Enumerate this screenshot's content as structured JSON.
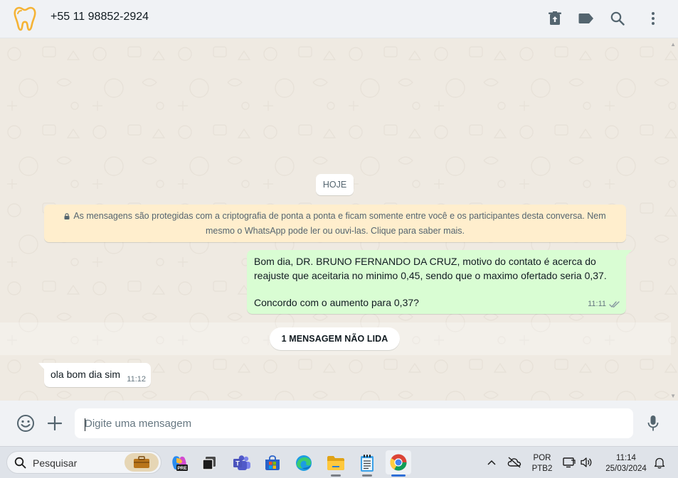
{
  "header": {
    "contact_name": "+55 11 98852-2924",
    "icons": [
      "tooth-logo-icon",
      "archive-icon",
      "label-icon",
      "search-icon",
      "more-vertical-icon"
    ]
  },
  "chat": {
    "date_separator": "HOJE",
    "encryption_notice": {
      "line1": "As mensagens são protegidas com a criptografia de ponta a ponta e ficam somente entre você e os participantes desta conversa. Nem",
      "line2": "mesmo o WhatsApp pode ler ou ouvi-las. Clique para saber mais."
    },
    "outgoing_message": {
      "line1": "Bom dia,  DR. BRUNO FERNANDO DA CRUZ, motivo do contato é acerca do",
      "line2": "reajuste que aceitaria no minimo 0,45, sendo que o maximo ofertado seria 0,37.",
      "line3": "Concordo com o aumento para 0,37?",
      "time": "11:11",
      "status": "read"
    },
    "unread_divider": "1 MENSAGEM NÃO LIDA",
    "incoming_message": {
      "text": "ola bom dia sim",
      "time": "11:12"
    }
  },
  "composer": {
    "placeholder": "Digite uma mensagem",
    "value": ""
  },
  "taskbar": {
    "search_label": "Pesquisar",
    "apps": [
      "work-briefcase-icon",
      "copilot-pre-icon",
      "task-view-icon",
      "teams-icon",
      "store-icon",
      "edge-icon",
      "file-explorer-icon",
      "notepad-icon",
      "chrome-icon"
    ],
    "language_line1": "POR",
    "language_line2": "PTB2",
    "time": "11:14",
    "date": "25/03/2024"
  },
  "colors": {
    "outgoing_bubble": "#d9fdd3",
    "incoming_bubble": "#ffffff",
    "encryption_banner": "#ffeecd",
    "chat_background": "#efeae2",
    "header_background": "#f0f2f5",
    "read_ticks": "#8696a0"
  }
}
